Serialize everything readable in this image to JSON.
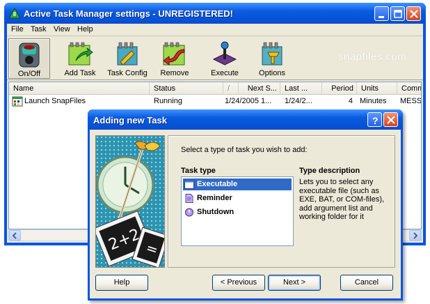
{
  "main_window": {
    "title": "Active Task Manager settings - UNREGISTERED!",
    "menu": [
      "File",
      "Task",
      "View",
      "Help"
    ],
    "toolbar": [
      {
        "label": "On/Off",
        "icon": "power-toggle-icon",
        "pressed": true
      },
      {
        "label": "Add Task",
        "icon": "add-task-icon"
      },
      {
        "label": "Task Config",
        "icon": "task-config-icon"
      },
      {
        "label": "Remove",
        "icon": "remove-task-icon"
      },
      {
        "label": "Execute",
        "icon": "execute-icon"
      },
      {
        "label": "Options",
        "icon": "options-icon"
      }
    ],
    "watermark": "snapfiles.com",
    "list": {
      "columns": [
        "Name",
        "Status",
        "/",
        "Next S...",
        "Last ...",
        "Period",
        "Units",
        "Comma"
      ],
      "rows": [
        {
          "name": "Launch SnapFiles",
          "status": "Running",
          "next": "1/24/2005 1...",
          "last": "1/24/2...",
          "period": "4",
          "units": "Minutes",
          "command": "MESSA"
        }
      ]
    }
  },
  "dialog": {
    "title": "Adding new Task",
    "prompt": "Select a type of task you wish to add:",
    "task_type_header": "Task type",
    "type_desc_header": "Type description",
    "task_types": [
      {
        "label": "Executable",
        "selected": true,
        "icon": "executable-window-icon"
      },
      {
        "label": "Reminder",
        "icon": "reminder-note-icon"
      },
      {
        "label": "Shutdown",
        "icon": "shutdown-power-icon"
      }
    ],
    "type_description": "Lets you to select any executable file (such as EXE, BAT, or COM-files), add argument list and working folder for it",
    "buttons": {
      "help": "Help",
      "previous": "< Previous",
      "next": "Next >",
      "cancel": "Cancel"
    }
  },
  "colors": {
    "titlebar_blue": "#0a5bdf",
    "window_face": "#ece9d8",
    "selection": "#316ac5",
    "close_red": "#d8431c"
  }
}
